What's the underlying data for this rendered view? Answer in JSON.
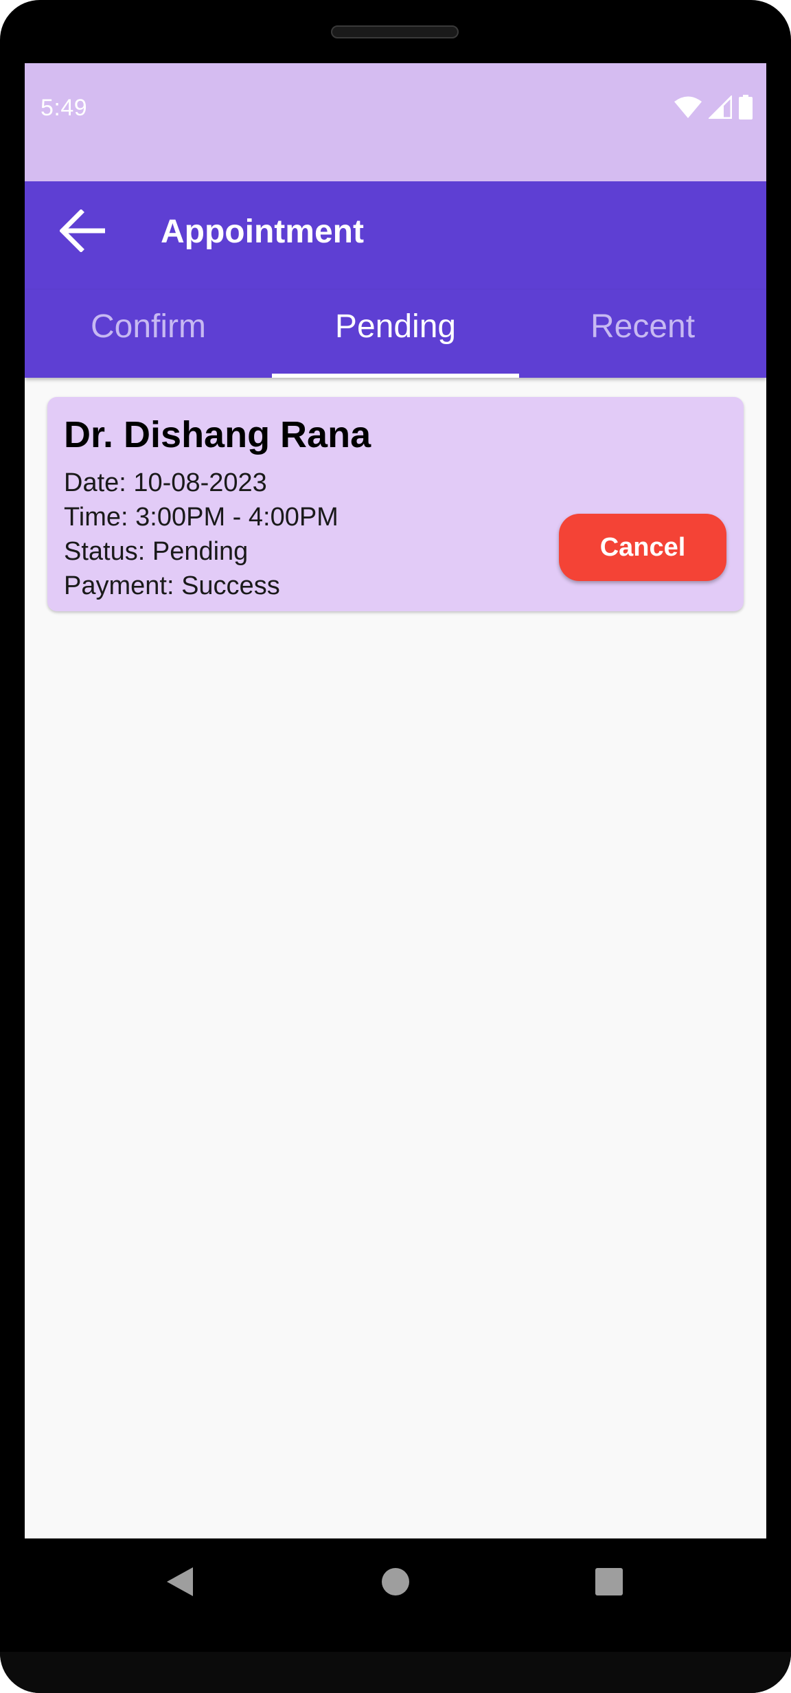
{
  "status_bar": {
    "time": "5:49",
    "icons": [
      "wifi-icon",
      "cellular-signal-icon",
      "battery-icon"
    ]
  },
  "app_bar": {
    "title": "Appointment",
    "back_icon": "arrow-back-icon"
  },
  "tabs": [
    {
      "label": "Confirm",
      "active": false
    },
    {
      "label": "Pending",
      "active": true
    },
    {
      "label": "Recent",
      "active": false
    }
  ],
  "appointments": [
    {
      "doctor": "Dr. Dishang Rana",
      "date": "Date: 10-08-2023",
      "time": "Time: 3:00PM - 4:00PM",
      "status": "Status: Pending",
      "payment": "Payment: Success",
      "action_label": "Cancel"
    }
  ],
  "navigation": {
    "buttons": [
      "back-triangle-icon",
      "home-circle-icon",
      "recents-square-icon"
    ]
  },
  "colors": {
    "status_bar": "#d5bcf1",
    "primary": "#5e3fd3",
    "card": "#e2cbf7",
    "cancel": "#f44336",
    "background": "#f9f9f9"
  }
}
